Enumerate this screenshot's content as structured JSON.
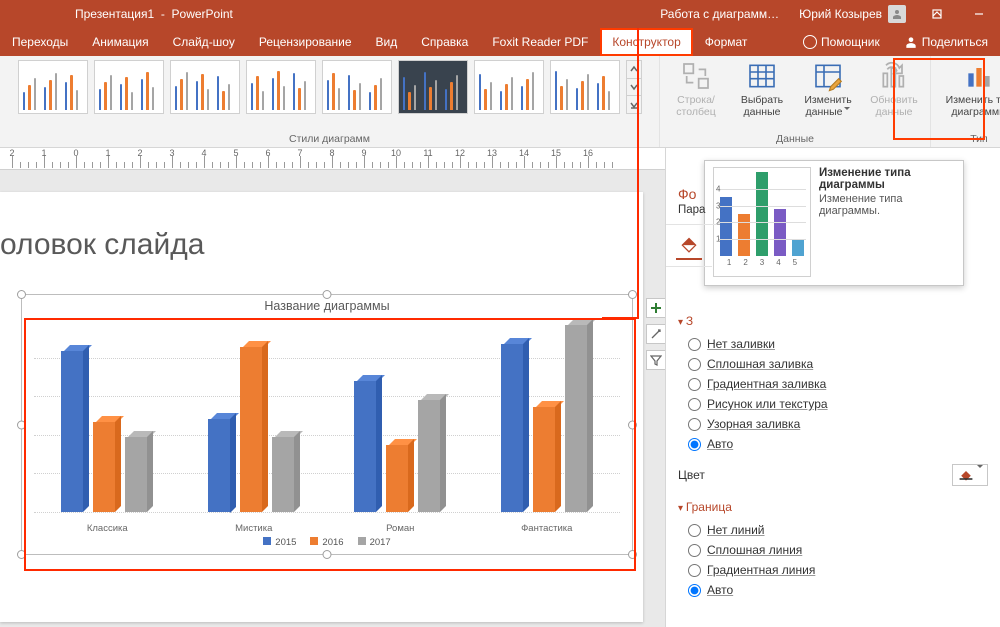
{
  "titlebar": {
    "doc": "Презентация1",
    "app": "PowerPoint",
    "chartwork": "Работа с диаграмм…",
    "user": "Юрий Козырев"
  },
  "tabs": {
    "list": [
      "Переходы",
      "Анимация",
      "Слайд-шоу",
      "Рецензирование",
      "Вид",
      "Справка",
      "Foxit Reader PDF",
      "Конструктор",
      "Формат"
    ],
    "active": "Конструктор",
    "tell": "Помощник",
    "share": "Поделиться"
  },
  "ribbon": {
    "styles_label": "Стили диаграмм",
    "data_label": "Данные",
    "type_label": "Тип",
    "row_col": "Строка/\nстолбец",
    "select_data": "Выбрать\nданные",
    "edit_data": "Изменить\nданные",
    "refresh": "Обновить\nданные",
    "change_type": "Изменить тип\nдиаграммы"
  },
  "slide": {
    "title": "оловок слайда",
    "chart_title": "Название диаграммы"
  },
  "pane": {
    "header": "Фо",
    "sub": "Пара",
    "section_fill": "З",
    "fill_options": {
      "no_fill": "Нет заливки",
      "solid": "Сплошная заливка",
      "gradient": "Градиентная заливка",
      "picture": "Рисунок или текстура",
      "pattern": "Узорная заливка",
      "auto": "Авто"
    },
    "color_label": "Цвет",
    "section_border": "Граница",
    "border_options": {
      "no_line": "Нет линий",
      "solid_line": "Сплошная линия",
      "gradient_line": "Градиентная линия",
      "auto": "Авто"
    }
  },
  "tooltip": {
    "title": "Изменение типа диаграммы",
    "body": "Изменение типа диаграммы."
  },
  "chart_data": {
    "type": "bar",
    "title": "Название диаграммы",
    "categories": [
      "Классика",
      "Мистика",
      "Роман",
      "Фантастика"
    ],
    "series": [
      {
        "name": "2015",
        "color": "#4472C4",
        "values": [
          4.3,
          2.5,
          3.5,
          4.5
        ]
      },
      {
        "name": "2016",
        "color": "#ED7D31",
        "values": [
          2.4,
          4.4,
          1.8,
          2.8
        ]
      },
      {
        "name": "2017",
        "color": "#A5A5A5",
        "values": [
          2.0,
          2.0,
          3.0,
          5.0
        ]
      }
    ],
    "ylim": [
      0,
      5
    ],
    "xlabel": "",
    "ylabel": ""
  },
  "tooltip_chart": {
    "type": "bar",
    "x": [
      1,
      2,
      3,
      4,
      5
    ],
    "values": [
      3.5,
      2.5,
      5.0,
      2.8,
      1.0
    ],
    "colors": [
      "#4472C4",
      "#ED7D31",
      "#2E9E6B",
      "#7A5BC4",
      "#4FA3D1"
    ],
    "ylim": [
      0,
      5
    ],
    "yticks": [
      1,
      2,
      3,
      4
    ]
  },
  "ruler": {
    "numbers": [
      2,
      1,
      0,
      1,
      2,
      3,
      4,
      5,
      6,
      7,
      8,
      9,
      10,
      11,
      12,
      13,
      14,
      15,
      16
    ]
  },
  "colors": {
    "accent": "#b7472a",
    "highlight": "#ff3b00"
  }
}
